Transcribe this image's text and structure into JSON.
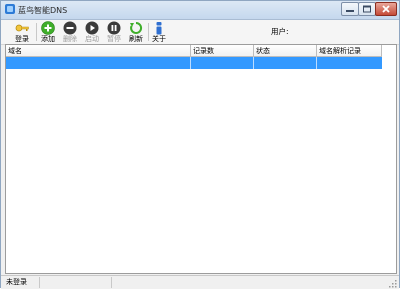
{
  "window": {
    "title": "蓝鸟智能DNS"
  },
  "toolbar": {
    "login": "登录",
    "add": "添加",
    "delete": "删除",
    "start": "启动",
    "pause": "暂停",
    "refresh": "刷新",
    "about": "关于",
    "user_label": "用户:"
  },
  "table": {
    "columns": [
      "域名",
      "记录数",
      "状态",
      "域名解析记录"
    ],
    "rows": [
      {
        "domain": "",
        "records": "",
        "status": "",
        "resolution": ""
      }
    ]
  },
  "statusbar": {
    "text": "未登录"
  },
  "colors": {
    "selection": "#3399ff",
    "titlebar": "#c5d8ee",
    "close_button": "#c44a37"
  }
}
